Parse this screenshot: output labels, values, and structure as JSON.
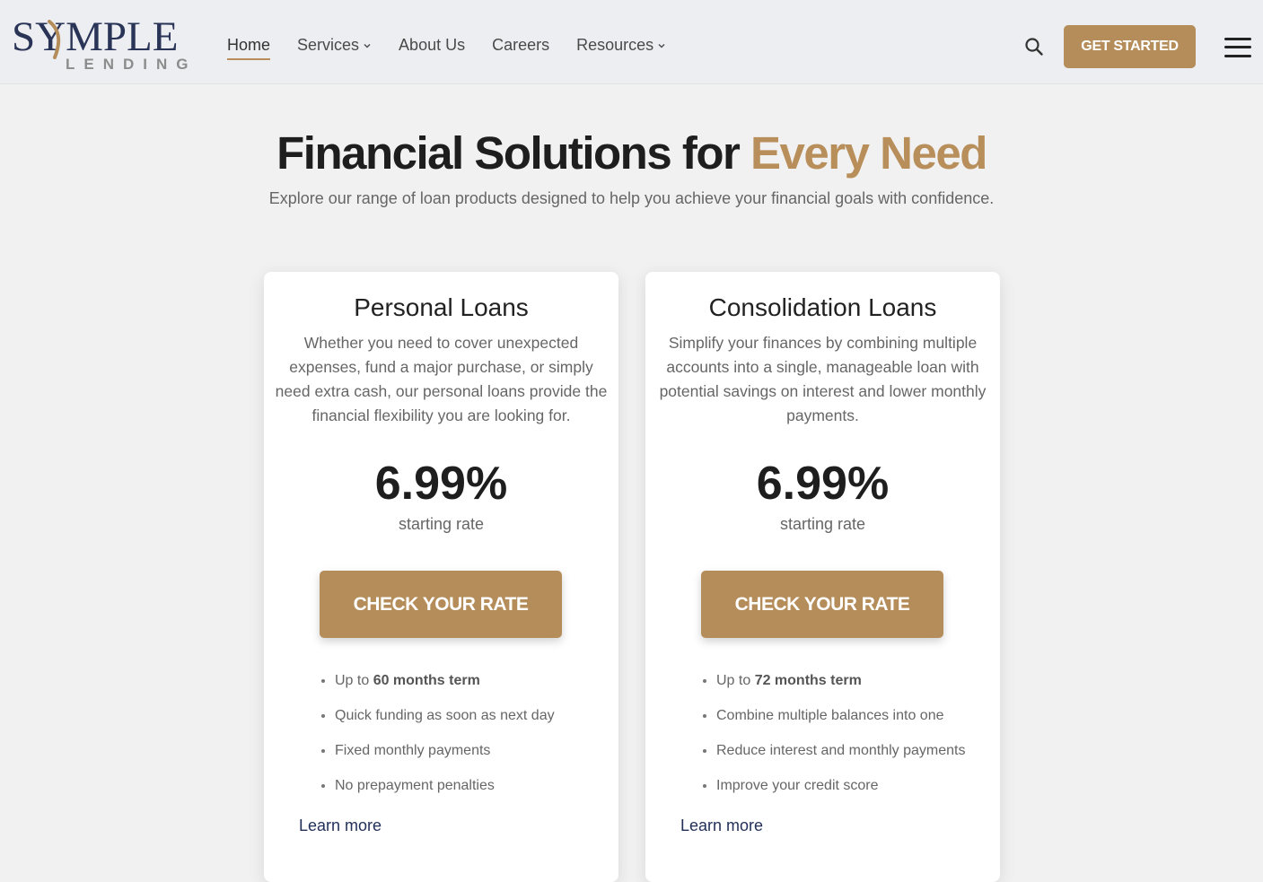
{
  "header": {
    "logo": {
      "main": "SYMPLE",
      "sub": "LENDING"
    },
    "nav": [
      {
        "label": "Home",
        "active": true,
        "has_dropdown": false
      },
      {
        "label": "Services",
        "active": false,
        "has_dropdown": true
      },
      {
        "label": "About Us",
        "active": false,
        "has_dropdown": false
      },
      {
        "label": "Careers",
        "active": false,
        "has_dropdown": false
      },
      {
        "label": "Resources",
        "active": false,
        "has_dropdown": true
      }
    ],
    "search_icon": "search-icon",
    "cta_label": "GET STARTED",
    "menu_icon": "hamburger-menu-icon"
  },
  "hero": {
    "title_main": "Financial Solutions for ",
    "title_accent": "Every Need",
    "subtitle": "Explore our range of loan products designed to help you achieve your financial goals with confidence."
  },
  "cards": [
    {
      "title": "Personal Loans",
      "description": "Whether you need to cover unexpected expenses, fund a major purchase, or simply need extra cash, our personal loans provide the financial flexibility you are looking for.",
      "rate": "6.99%",
      "rate_label": "starting rate",
      "cta_label": "CHECK YOUR RATE",
      "features": [
        {
          "prefix": "Up to ",
          "bold": "60 months term"
        },
        {
          "prefix": "Quick funding as soon as next day",
          "bold": ""
        },
        {
          "prefix": "Fixed monthly payments",
          "bold": ""
        },
        {
          "prefix": "No prepayment penalties",
          "bold": ""
        }
      ],
      "link_label": "Learn more"
    },
    {
      "title": "Consolidation Loans",
      "description": "Simplify your finances by combining multiple accounts into a single, manageable loan with potential savings on interest and lower monthly payments.",
      "rate": "6.99%",
      "rate_label": "starting rate",
      "cta_label": "CHECK YOUR RATE",
      "features": [
        {
          "prefix": "Up to ",
          "bold": "72 months term"
        },
        {
          "prefix": "Combine multiple balances into one",
          "bold": ""
        },
        {
          "prefix": "Reduce interest and monthly payments",
          "bold": ""
        },
        {
          "prefix": "Improve your credit score",
          "bold": ""
        }
      ],
      "link_label": "Learn more"
    }
  ],
  "colors": {
    "accent": "#b58d5a",
    "brand_navy": "#2a3457",
    "page_bg": "#f1f1f1",
    "header_bg": "#eceef1"
  }
}
